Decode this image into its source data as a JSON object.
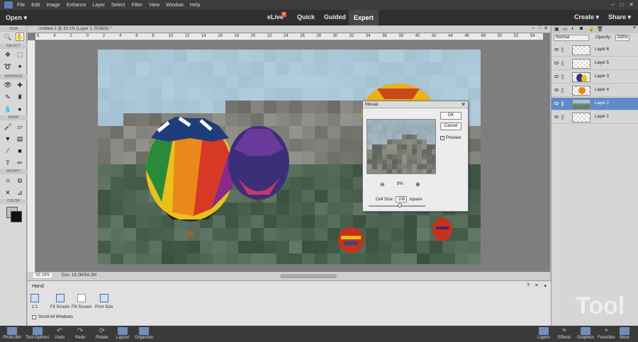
{
  "menu": {
    "items": [
      "File",
      "Edit",
      "Image",
      "Enhance",
      "Layer",
      "Select",
      "Filter",
      "View",
      "Window",
      "Help"
    ]
  },
  "modes": {
    "open": "Open",
    "elive": "eLive",
    "elive_badge": "1",
    "quick": "Quick",
    "guided": "Guided",
    "expert": "Expert",
    "create": "Create",
    "share": "Share"
  },
  "toolbox": {
    "sections": [
      "VIEW",
      "SELECT",
      "ENHANCE",
      "DRAW",
      "MODIFY",
      "COLOR"
    ],
    "foreground": "#111111",
    "background": "#ffffff"
  },
  "document": {
    "tab_title": "Untitled-1 @ 33.1% (Layer 2, RGB/8) *",
    "zoom": "33.19%",
    "doc_size": "Doc: 19.2M/54.2M",
    "ruler_labels": [
      "6",
      "4",
      "2",
      "0",
      "2",
      "4",
      "6",
      "8",
      "10",
      "12",
      "14",
      "16",
      "18",
      "20",
      "22",
      "24",
      "26",
      "28",
      "30",
      "32",
      "34",
      "36",
      "38",
      "40",
      "42",
      "44",
      "46",
      "48",
      "50",
      "52",
      "54"
    ]
  },
  "layers_panel": {
    "blend_mode": "Normal",
    "opacity_label": "Opacity:",
    "opacity": "100%",
    "layers": [
      {
        "name": "Layer 6",
        "selected": false
      },
      {
        "name": "Layer 5",
        "selected": false
      },
      {
        "name": "Layer 3",
        "selected": false
      },
      {
        "name": "Layer 4",
        "selected": false
      },
      {
        "name": "Layer 2",
        "selected": true
      },
      {
        "name": "Layer 1",
        "selected": false
      }
    ]
  },
  "dialog": {
    "title": "Mosaic",
    "ok": "OK",
    "cancel": "Cancel",
    "preview": "Preview",
    "zoom": "8%",
    "cell_size_label": "Cell Size:",
    "cell_size": "108",
    "unit": "square",
    "slider_level": 0.55
  },
  "tool_options": {
    "tool": "Hand",
    "options": [
      {
        "label": "1:1"
      },
      {
        "label": "Fit Screen"
      },
      {
        "label": "Fill Screen"
      },
      {
        "label": "Print Size"
      }
    ],
    "scroll_all": "Scroll All Windows"
  },
  "taskbar": {
    "left": [
      "Photo Bin",
      "Tool Options",
      "Undo",
      "Redo",
      "Rotate",
      "Layout",
      "Organizer"
    ],
    "right": [
      "Layers",
      "Effects",
      "Graphics",
      "Favorites",
      "More"
    ]
  },
  "colors": {
    "accent": "#5f8bc9",
    "mode_bar": "#2f2f2f",
    "sky": "#a9c2d3"
  }
}
